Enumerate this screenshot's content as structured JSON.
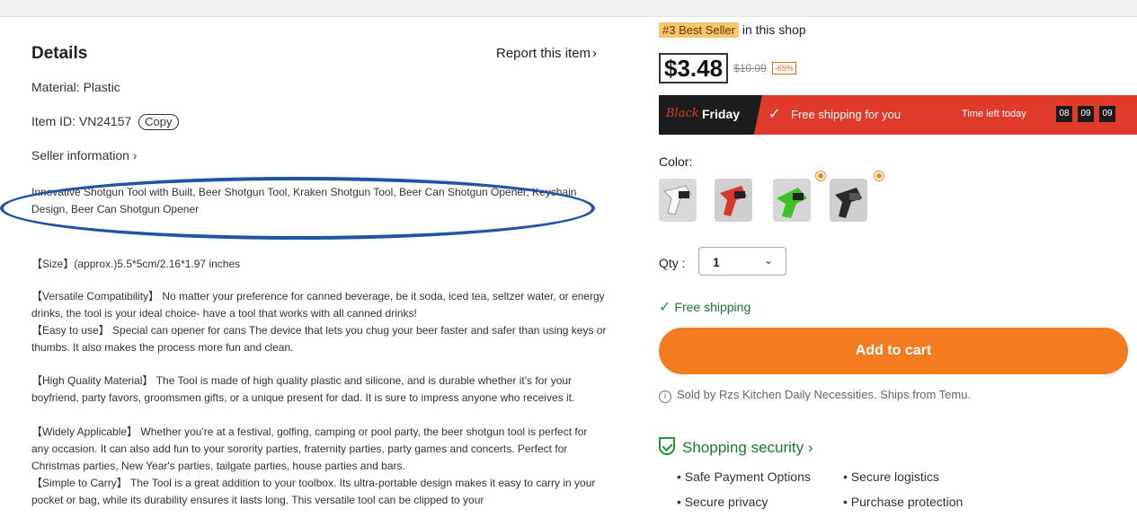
{
  "details": {
    "title": "Details",
    "report_label": "Report this item",
    "material": "Material: Plastic",
    "item_id": "Item ID: VN24157",
    "copy_label": "Copy",
    "seller_info": "Seller information",
    "product_title": "Innovative Shotgun Tool with Built, Beer Shotgun Tool, Kraken Shotgun Tool, Beer Can Shotgun Opener, Keychain Design, Beer Can Shotgun Opener",
    "size": "【Size】(approx.)5.5*5cm/2.16*1.97 inches",
    "versatile": "【Versatile Compatibility】 No matter your preference for canned beverage, be it soda, iced tea, seltzer water, or energy drinks, the tool is your ideal choice- have a tool that works with all canned drinks!",
    "easy": "【Easy to use】 Special can opener for cans The device that lets you chug your beer faster and safer than using keys or thumbs. It also makes the process more fun and clean.",
    "quality": "【High Quality Material】 The Tool is made of high quality plastic and silicone, and is durable whether it's for your boyfriend, party favors, groomsmen gifts, or a unique present for dad. It is sure to impress anyone who receives it.",
    "widely": "【Widely Applicable】 Whether you're at a festival, golfing, camping or pool party, the beer shotgun tool is perfect for any occasion. It can also add fun to your sorority parties, fraternity parties, party games and concerts. Perfect for Christmas parties, New Year's parties, tailgate parties, house parties and bars.",
    "simple": "【Simple to Carry】 The Tool is a great addition to your toolbox. Its ultra-portable design makes it easy to carry in your pocket or bag, while its durability ensures it lasts long. This versatile tool can be clipped to your"
  },
  "purchase": {
    "bestseller_badge": "#3 Best Seller",
    "bestseller_suffix": "in this shop",
    "price": "$3.48",
    "old_price": "$10.09",
    "discount": "-65%",
    "promo": {
      "black_script": "Black",
      "friday": "Friday",
      "free_shipping": "Free shipping for you",
      "time_left": "Time left today",
      "timer": [
        "08",
        "09",
        "09"
      ]
    },
    "color_label": "Color:",
    "qty_label": "Qty :",
    "qty_value": "1",
    "free_shipping": "Free shipping",
    "add_to_cart": "Add to cart",
    "sold_by": "Sold by Rzs Kitchen Daily Necessities. Ships from Temu.",
    "security_title": "Shopping security",
    "security_items": [
      "Safe Payment Options",
      "Secure logistics",
      "Secure privacy",
      "Purchase protection"
    ]
  },
  "colors": {
    "accent_orange": "#f47b20",
    "promo_red": "#e03a2a",
    "success_green": "#1b9a35",
    "highlight_blue": "#2055a5"
  }
}
